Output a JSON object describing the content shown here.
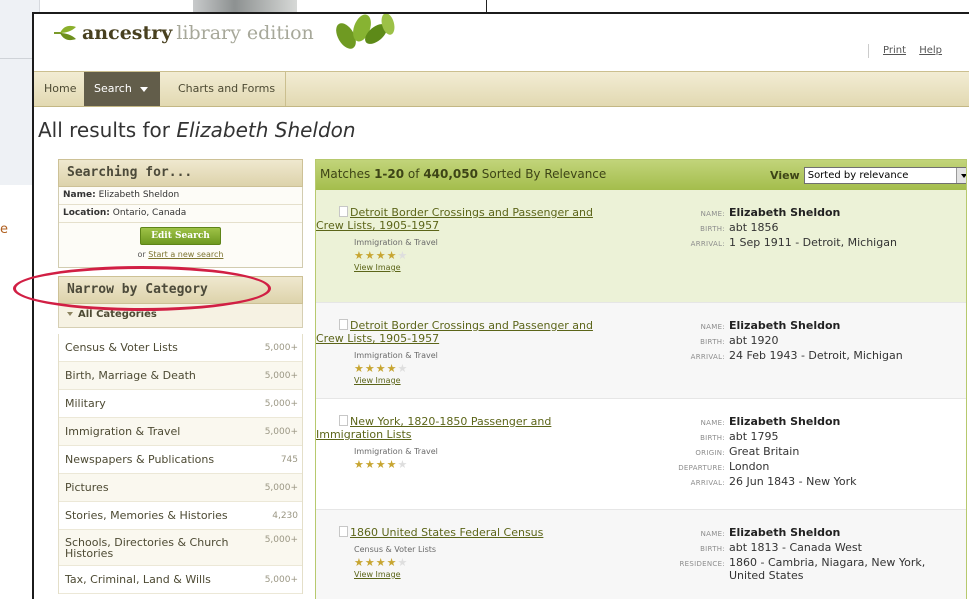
{
  "background": {
    "left_fragment_letter": "e"
  },
  "header": {
    "logo_main": "ancestry",
    "logo_sub": "library edition",
    "links": [
      "Print",
      "Help"
    ]
  },
  "nav": {
    "home": "Home",
    "search": "Search",
    "charts": "Charts and Forms"
  },
  "page": {
    "title_prefix": "All results for ",
    "title_query": "Elizabeth Sheldon"
  },
  "searching_for": {
    "heading": "Searching for...",
    "rows": [
      {
        "label": "Name:",
        "value": "Elizabeth Sheldon"
      },
      {
        "label": "Location:",
        "value": "Ontario, Canada"
      }
    ],
    "edit_button": "Edit Search",
    "or_text": "or",
    "new_search_link": "Start a new search"
  },
  "narrow": {
    "heading": "Narrow by Category",
    "all_categories": "All Categories",
    "categories": [
      {
        "label": "Census & Voter Lists",
        "count": "5,000+"
      },
      {
        "label": "Birth, Marriage & Death",
        "count": "5,000+"
      },
      {
        "label": "Military",
        "count": "5,000+"
      },
      {
        "label": "Immigration & Travel",
        "count": "5,000+"
      },
      {
        "label": "Newspapers & Publications",
        "count": "745"
      },
      {
        "label": "Pictures",
        "count": "5,000+"
      },
      {
        "label": "Stories, Memories & Histories",
        "count": "4,230"
      },
      {
        "label": "Schools, Directories & Church Histories",
        "count": "5,000+"
      },
      {
        "label": "Tax, Criminal, Land & Wills",
        "count": "5,000+"
      }
    ]
  },
  "results": {
    "matches_prefix": "Matches ",
    "range": "1-20",
    "of": " of ",
    "total": "440,050",
    "sorted_by": " Sorted By Relevance",
    "view_label": "View",
    "view_selected": "Sorted by relevance",
    "items": [
      {
        "title": "Detroit Border Crossings and Passenger and Crew Lists, 1905-1957",
        "category": "Immigration & Travel",
        "stars": 4,
        "view_image": "View Image",
        "fields": [
          {
            "key": "NAME:",
            "value": "Elizabeth Sheldon",
            "bold": true
          },
          {
            "key": "BIRTH:",
            "value": "abt 1856"
          },
          {
            "key": "ARRIVAL:",
            "value": "1 Sep 1911 - Detroit, Michigan"
          }
        ]
      },
      {
        "title": "Detroit Border Crossings and Passenger and Crew Lists, 1905-1957",
        "category": "Immigration & Travel",
        "stars": 4,
        "view_image": "View Image",
        "fields": [
          {
            "key": "NAME:",
            "value": "Elizabeth Sheldon",
            "bold": true
          },
          {
            "key": "BIRTH:",
            "value": "abt 1920"
          },
          {
            "key": "ARRIVAL:",
            "value": "24 Feb 1943 - Detroit, Michigan"
          }
        ]
      },
      {
        "title": "New York, 1820-1850 Passenger and Immigration Lists",
        "category": "Immigration & Travel",
        "stars": 4,
        "view_image": "",
        "fields": [
          {
            "key": "NAME:",
            "value": "Elizabeth Sheldon",
            "bold": true
          },
          {
            "key": "BIRTH:",
            "value": "abt 1795"
          },
          {
            "key": "ORIGIN:",
            "value": "Great Britain"
          },
          {
            "key": "DEPARTURE:",
            "value": "London"
          },
          {
            "key": "ARRIVAL:",
            "value": "26 Jun 1843 - New York"
          }
        ]
      },
      {
        "title": "1860 United States Federal Census",
        "category": "Census & Voter Lists",
        "stars": 4,
        "view_image": "View Image",
        "fields": [
          {
            "key": "NAME:",
            "value": "Elizabeth Sheldon",
            "bold": true
          },
          {
            "key": "BIRTH:",
            "value": "abt 1813 - Canada West"
          },
          {
            "key": "RESIDENCE:",
            "value": "1860 - Cambria, Niagara, New York, United States"
          }
        ]
      }
    ]
  },
  "colors": {
    "annotation_oval": "#d11f44",
    "results_header": "#a4bd4c",
    "nav_active": "#625d4a",
    "star": "#c7a531"
  }
}
